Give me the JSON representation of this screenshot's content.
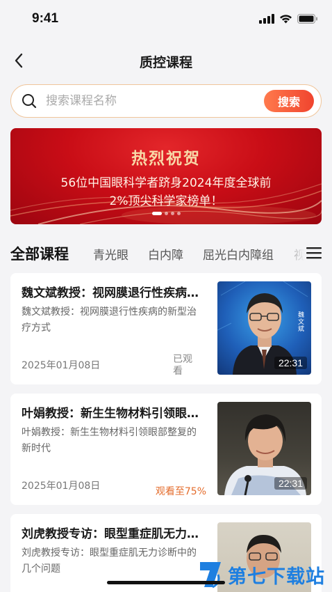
{
  "status_bar": {
    "time": "9:41"
  },
  "nav": {
    "title": "质控课程"
  },
  "search": {
    "placeholder": "搜索课程名称",
    "button_label": "搜索"
  },
  "banner": {
    "title": "热烈祝贺",
    "line1": "56位中国眼科学者跻身2024年度全球前",
    "line2": "2%顶尖科学家榜单！",
    "slide_count": 4,
    "active_slide": 1
  },
  "tabs": {
    "heading": "全部课程",
    "items": [
      "青光眼",
      "白内障",
      "屈光白内障组",
      "视"
    ]
  },
  "courses": [
    {
      "title": "魏文斌教授：视网膜退行性疾病的新型治疗方式",
      "description": "魏文斌教授：视网膜退行性疾病的新型治疗方式",
      "date": "2025年01月08日",
      "status": "已观看",
      "duration": "22:31",
      "thumb_name_text": "魏文斌"
    },
    {
      "title": "叶娟教授：新生生物材料引领眼部整复的新时代",
      "description": "叶娟教授：新生生物材料引领眼部整复的新时代",
      "date": "2025年01月08日",
      "status": "观看至75%",
      "duration": "22:31"
    },
    {
      "title": "刘虎教授专访：眼型重症肌无力诊断中的几个问题",
      "description": "刘虎教授专访：眼型重症肌无力诊断中的几个问题"
    }
  ],
  "watermark": {
    "text": "第七下载站"
  },
  "colors": {
    "accent": "#f0442e",
    "banner_red": "#c90d16",
    "progress": "#e46c2c",
    "watermark": "#1e7fe0"
  }
}
